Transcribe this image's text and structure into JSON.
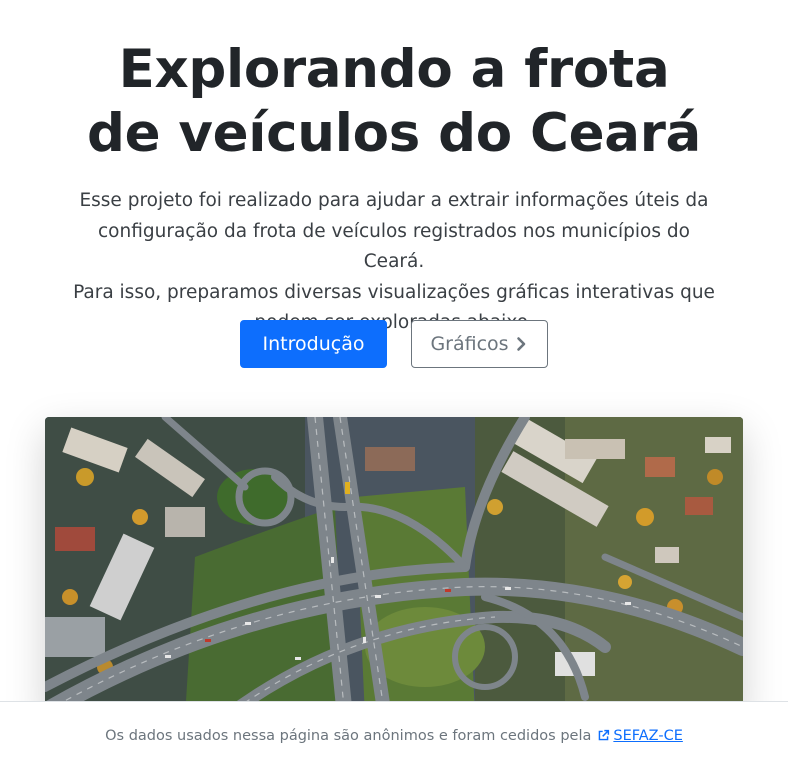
{
  "hero": {
    "title_line1": "Explorando a frota",
    "title_line2": "de veículos do Ceará",
    "lead_line1": "Esse projeto foi realizado para ajudar a extrair informações úteis da",
    "lead_line2": "configuração da frota de veículos registrados nos municípios do Ceará.",
    "lead_line3": "Para isso, preparamos diversas visualizações gráficas interativas que",
    "lead_line4": "podem ser exploradas abaixo."
  },
  "buttons": {
    "intro_label": "Introdução",
    "charts_label": "Gráficos",
    "charts_icon": "chevron-right-icon"
  },
  "image": {
    "alt": "Aerial view of a highway interchange in a city"
  },
  "footer": {
    "text": "Os dados usados nessa página são anônimos e foram cedidos pela",
    "link_label": "SEFAZ-CE",
    "link_icon": "external-link-icon"
  },
  "colors": {
    "primary": "#0d6efd",
    "secondary": "#6c757d",
    "text": "#212529"
  }
}
